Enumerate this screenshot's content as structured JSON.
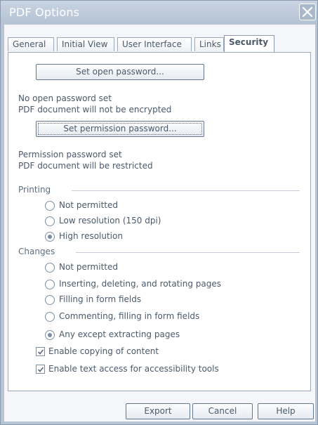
{
  "window": {
    "title": "PDF Options"
  },
  "tabs": [
    {
      "label": "General"
    },
    {
      "label": "Initial View"
    },
    {
      "label": "User Interface"
    },
    {
      "label": "Links"
    },
    {
      "label": "Security",
      "active": true
    }
  ],
  "security": {
    "open_password_button": "Set open password...",
    "open_status_line1": "No open password set",
    "open_status_line2": "PDF document will not be encrypted",
    "permission_password_button": "Set permission password...",
    "permission_status_line1": "Permission password set",
    "permission_status_line2": "PDF document will be restricted"
  },
  "printing": {
    "label": "Printing",
    "options": [
      {
        "label": "Not permitted",
        "selected": false
      },
      {
        "label": "Low resolution (150 dpi)",
        "selected": false
      },
      {
        "label": "High resolution",
        "selected": true
      }
    ]
  },
  "changes": {
    "label": "Changes",
    "options": [
      {
        "label": "Not permitted",
        "selected": false
      },
      {
        "label": "Inserting, deleting, and rotating pages",
        "selected": false
      },
      {
        "label": "Filling in form fields",
        "selected": false
      },
      {
        "label": "Commenting, filling in form fields",
        "selected": false
      },
      {
        "label": "Any except extracting pages",
        "selected": true
      }
    ]
  },
  "checkboxes": [
    {
      "label": "Enable copying of content",
      "checked": true
    },
    {
      "label": "Enable text access for accessibility tools",
      "checked": true
    }
  ],
  "footer": {
    "export_label": "Export",
    "cancel_label": "Cancel",
    "help_label": "Help"
  }
}
